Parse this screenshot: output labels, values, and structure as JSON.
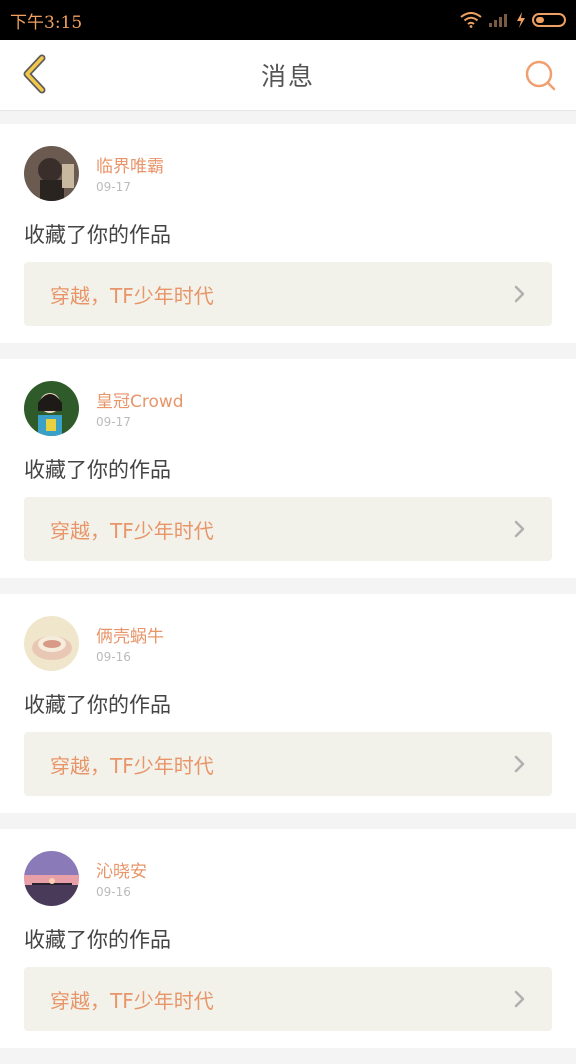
{
  "status": {
    "time": "下午3:15"
  },
  "header": {
    "title": "消息"
  },
  "items": [
    {
      "name": "临界唯霸",
      "date": "09-17",
      "action": "收藏了你的作品",
      "work": "穿越，TF少年时代"
    },
    {
      "name": "皇冠Crowd",
      "date": "09-17",
      "action": "收藏了你的作品",
      "work": "穿越，TF少年时代"
    },
    {
      "name": "俩壳蜗牛",
      "date": "09-16",
      "action": "收藏了你的作品",
      "work": "穿越，TF少年时代"
    },
    {
      "name": "沁晓安",
      "date": "09-16",
      "action": "收藏了你的作品",
      "work": "穿越，TF少年时代"
    }
  ],
  "colors": {
    "accent": "#e8956a",
    "workBg": "#f3f2ea",
    "backIcon": "#f2c84b",
    "searchIcon": "#f0a070"
  }
}
